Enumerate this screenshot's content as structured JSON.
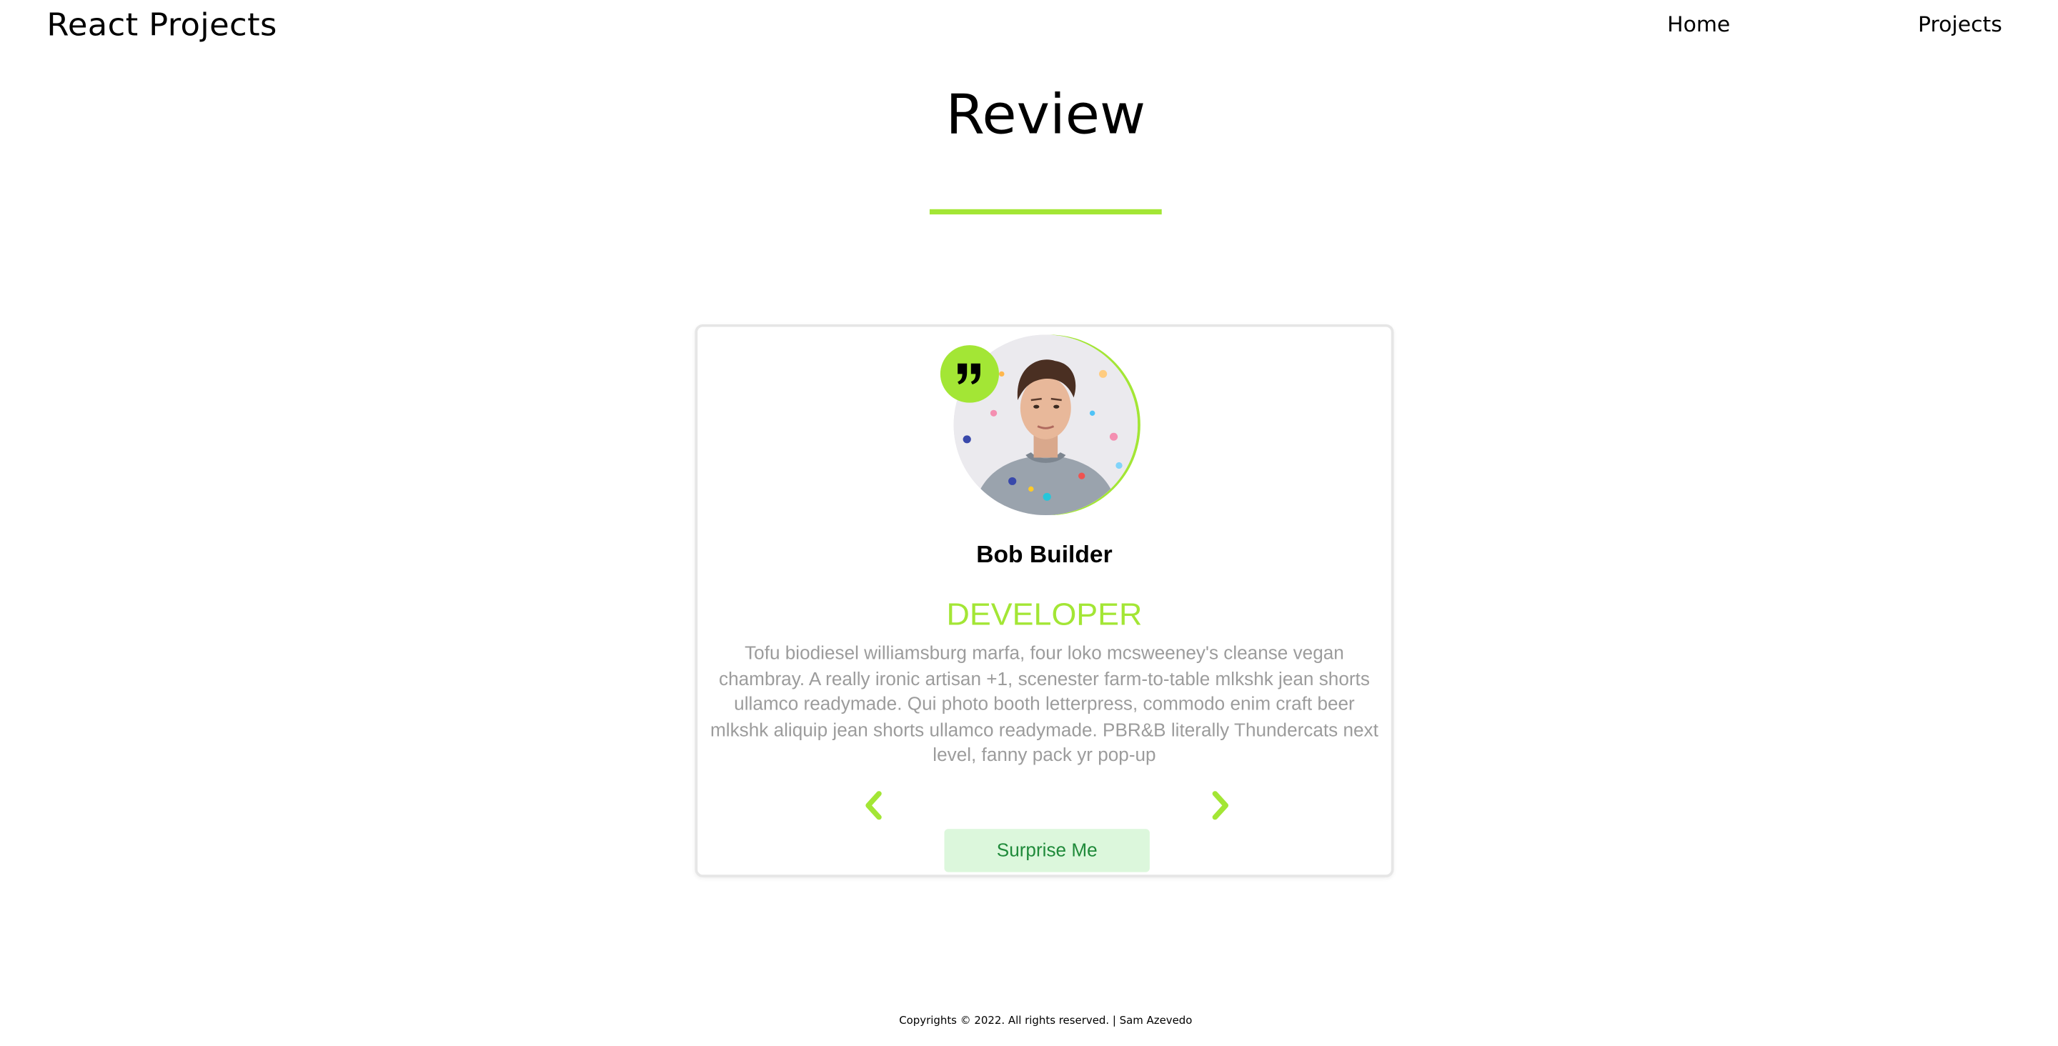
{
  "header": {
    "brand": "React Projects",
    "nav": [
      {
        "label": "Home"
      },
      {
        "label": "Projects"
      }
    ]
  },
  "main": {
    "title": "Review"
  },
  "review": {
    "name": "Bob Builder",
    "job": "DEVELOPER",
    "text": "Tofu biodiesel williamsburg marfa, four loko mcsweeney's cleanse vegan chambray. A really ironic artisan +1, scenester farm-to-table mlkshk jean shorts ullamco readymade. Qui photo booth letterpress, commodo enim craft beer mlkshk aliquip jean shorts ullamco readymade. PBR&B literally Thundercats next level, fanny pack yr pop-up",
    "surprise_label": "Surprise Me",
    "icons": {
      "quote": "quote-icon",
      "prev": "chevron-left-icon",
      "next": "chevron-right-icon",
      "avatar": "avatar-photo"
    }
  },
  "footer": {
    "text": "Copyrights © 2022. All rights reserved. | Sam Azevedo"
  },
  "colors": {
    "accent": "#a3e635",
    "muted_text": "#9c9c9c",
    "button_bg": "#dcf7dc",
    "button_text": "#1f8a3a"
  }
}
